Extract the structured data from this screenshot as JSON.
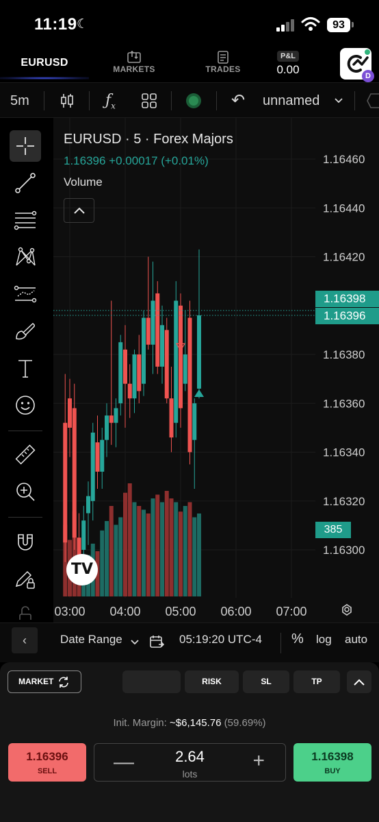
{
  "status_bar": {
    "time": "11:19",
    "battery": "93"
  },
  "nav": {
    "symbol": "EURUSD",
    "markets": "MARKETS",
    "trades": "TRADES",
    "pnl_label": "P&L",
    "pnl_value": "0.00",
    "logo_badge": "D"
  },
  "toolbar": {
    "interval": "5m",
    "layout_name": "unnamed"
  },
  "chart": {
    "title": "EURUSD · 5 · Forex Majors",
    "quote": "1.16396  +0.00017 (+0.01%)",
    "volume_label": "Volume",
    "price_ticks": [
      "1.16460",
      "1.16440",
      "1.16420",
      "1.16380",
      "1.16360",
      "1.16340",
      "1.16320",
      "1.16300"
    ],
    "tag_ask": "1.16398",
    "tag_bid": "1.16396",
    "tag_volume": "385",
    "time_ticks": [
      "03:00",
      "04:00",
      "05:00",
      "06:00",
      "07:00"
    ],
    "colors": {
      "up": "#26a69a",
      "down": "#ef5350"
    }
  },
  "chart_data": {
    "type": "candlestick",
    "title": "EURUSD · 5 · Forex Majors",
    "ylim": [
      1.16295,
      1.16467
    ],
    "xlim": [
      "02:55",
      "07:25"
    ],
    "grid": true,
    "candles": [
      {
        "t": "02:55",
        "o": 1.16352,
        "h": 1.16372,
        "l": 1.16295,
        "c": 1.16303
      },
      {
        "t": "03:00",
        "o": 1.16362,
        "h": 1.1637,
        "l": 1.16338,
        "c": 1.1635
      },
      {
        "t": "03:05",
        "o": 1.16358,
        "h": 1.16368,
        "l": 1.163,
        "c": 1.16305
      },
      {
        "t": "03:10",
        "o": 1.16305,
        "h": 1.16315,
        "l": 1.1629,
        "c": 1.16298
      },
      {
        "t": "03:15",
        "o": 1.163,
        "h": 1.16318,
        "l": 1.16295,
        "c": 1.16312
      },
      {
        "t": "03:20",
        "o": 1.16315,
        "h": 1.16328,
        "l": 1.16302,
        "c": 1.16322
      },
      {
        "t": "03:25",
        "o": 1.1632,
        "h": 1.16352,
        "l": 1.16312,
        "c": 1.16348
      },
      {
        "t": "03:30",
        "o": 1.16344,
        "h": 1.16355,
        "l": 1.16325,
        "c": 1.16332
      },
      {
        "t": "03:35",
        "o": 1.16332,
        "h": 1.1635,
        "l": 1.16325,
        "c": 1.16345
      },
      {
        "t": "03:40",
        "o": 1.16345,
        "h": 1.1636,
        "l": 1.16338,
        "c": 1.16355
      },
      {
        "t": "03:45",
        "o": 1.16355,
        "h": 1.16402,
        "l": 1.16343,
        "c": 1.16352
      },
      {
        "t": "03:50",
        "o": 1.16352,
        "h": 1.16362,
        "l": 1.16342,
        "c": 1.16358
      },
      {
        "t": "03:55",
        "o": 1.1636,
        "h": 1.16388,
        "l": 1.16355,
        "c": 1.16385
      },
      {
        "t": "04:00",
        "o": 1.16382,
        "h": 1.16392,
        "l": 1.1635,
        "c": 1.16368
      },
      {
        "t": "04:05",
        "o": 1.16368,
        "h": 1.16376,
        "l": 1.16354,
        "c": 1.16362
      },
      {
        "t": "04:10",
        "o": 1.16362,
        "h": 1.16382,
        "l": 1.16356,
        "c": 1.1638
      },
      {
        "t": "04:15",
        "o": 1.1638,
        "h": 1.16388,
        "l": 1.1636,
        "c": 1.16365
      },
      {
        "t": "04:20",
        "o": 1.16368,
        "h": 1.16398,
        "l": 1.16363,
        "c": 1.16395
      },
      {
        "t": "04:25",
        "o": 1.16395,
        "h": 1.1642,
        "l": 1.16382,
        "c": 1.16384
      },
      {
        "t": "04:30",
        "o": 1.16384,
        "h": 1.16418,
        "l": 1.16372,
        "c": 1.16402
      },
      {
        "t": "04:35",
        "o": 1.16405,
        "h": 1.1641,
        "l": 1.16372,
        "c": 1.16375
      },
      {
        "t": "04:40",
        "o": 1.16375,
        "h": 1.164,
        "l": 1.16368,
        "c": 1.16392
      },
      {
        "t": "04:45",
        "o": 1.1639,
        "h": 1.16395,
        "l": 1.1636,
        "c": 1.16362
      },
      {
        "t": "04:50",
        "o": 1.16362,
        "h": 1.16375,
        "l": 1.1634,
        "c": 1.16346
      },
      {
        "t": "04:55",
        "o": 1.16352,
        "h": 1.1641,
        "l": 1.16346,
        "c": 1.16402
      },
      {
        "t": "05:00",
        "o": 1.164,
        "h": 1.16405,
        "l": 1.1635,
        "c": 1.16358
      },
      {
        "t": "05:05",
        "o": 1.16368,
        "h": 1.16398,
        "l": 1.16365,
        "c": 1.1638
      },
      {
        "t": "05:10",
        "o": 1.16395,
        "h": 1.16402,
        "l": 1.16335,
        "c": 1.1634
      },
      {
        "t": "05:15",
        "o": 1.16345,
        "h": 1.16362,
        "l": 1.16325,
        "c": 1.1636
      },
      {
        "t": "05:20",
        "o": 1.16366,
        "h": 1.16423,
        "l": 1.16362,
        "c": 1.16396
      }
    ],
    "volume": [
      38,
      30,
      45,
      25,
      20,
      22,
      28,
      24,
      35,
      40,
      48,
      38,
      42,
      55,
      60,
      50,
      48,
      46,
      44,
      52,
      54,
      50,
      56,
      52,
      50,
      45,
      48,
      50,
      42,
      44
    ],
    "volume_max": 385,
    "markers": [
      {
        "t": "05:00",
        "price": 1.16383,
        "kind": "sell-triangle"
      },
      {
        "t": "05:20",
        "price": 1.16364,
        "kind": "buy-triangle"
      }
    ],
    "last_price": 1.16396,
    "ask_price": 1.16398
  },
  "bottom_bar": {
    "date_range": "Date Range",
    "clock": "05:19:20 UTC-4",
    "percent": "%",
    "log": "log",
    "auto": "auto"
  },
  "order": {
    "market_btn": "MARKET",
    "risk": "RISK",
    "sl": "SL",
    "tp": "TP",
    "margin_label": "Init. Margin:",
    "margin_value": "~$6,145.76",
    "margin_pct": "(59.69%)",
    "sell_price": "1.16396",
    "sell_label": "SELL",
    "buy_price": "1.16398",
    "buy_label": "BUY",
    "lots_value": "2.64",
    "lots_label": "lots"
  }
}
